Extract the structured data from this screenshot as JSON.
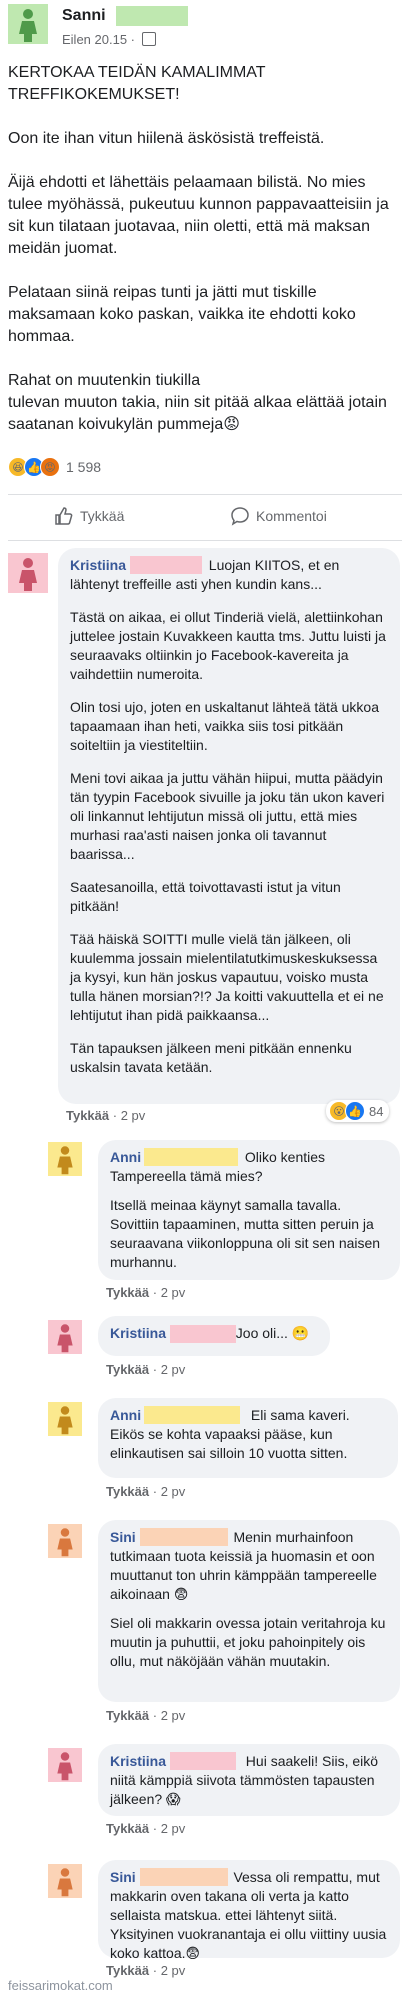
{
  "post": {
    "author": "Sanni",
    "time": "Eilen 20.15 · ",
    "paragraphs": [
      "KERTOKAA TEIDÄN KAMALIMMAT TREFFIKOKEMUKSET!",
      "Oon ite ihan vitun hiilenä äskösistä treffeistä.",
      "Äijä ehdotti et lähettäis pelaamaan bilistä. No mies tulee myöhässä, pukeutuu kunnon pappavaatteisiin ja sit kun tilataan juotavaa, niin oletti, että mä maksan meidän juomat.",
      "Pelataan siinä reipas tunti ja jätti mut tiskille maksamaan koko paskan, vaikka ite ehdotti koko hommaa.",
      "Rahat on muutenkin tiukilla\ntulevan muuton takia, niin sit pitää alkaa elättää jotain saatanan koivukylän pummeja😡"
    ],
    "reaction_count": "1 598"
  },
  "actions": {
    "like": "Tykkää",
    "comment": "Kommentoi"
  },
  "comments": [
    {
      "name": "Kristiina",
      "first": "Luojan KIITOS, et en lähtenyt treffeille asti yhen kundin kans...",
      "paragraphs": [
        "Tästä on aikaa, ei ollut Tinderiä vielä, alettiinkohan juttelee jostain Kuvakkeen kautta tms. Juttu luisti ja seuraavaks oltiinkin jo Facebook-kavereita ja vaihdettiin numeroita.",
        "Olin tosi ujo, joten en uskaltanut lähteä tätä ukkoa tapaamaan ihan heti, vaikka siis tosi pitkään soiteltiin ja viestiteltiin.",
        "Meni tovi aikaa ja juttu vähän hiipui, mutta päädyin tän tyypin Facebook sivuille ja joku tän ukon kaveri oli linkannut lehtijutun missä oli juttu, että mies murhasi raa'asti naisen jonka oli tavannut baarissa...",
        "Saatesanoilla, että toivottavasti istut ja vitun pitkään!",
        "Tää häiskä SOITTI mulle vielä tän jälkeen, oli kuulemma jossain mielentilatutkimuskeskuksessa ja kysyi, kun hän joskus vapautuu, voisko musta tulla hänen morsian?!? Ja koitti vakuuttella et ei ne lehtijutut ihan pidä paikkaansa...",
        "Tän tapauksen jälkeen meni pitkään ennenku uskalsin tavata ketään."
      ],
      "meta": "2 pv",
      "reaction_count": "84"
    },
    {
      "name": "Anni",
      "first": "Oliko kenties Tampereella tämä mies?",
      "paragraphs": [
        "Itsellä meinaa käynyt samalla tavalla. Sovittiin tapaaminen, mutta sitten peruin ja seuraavana viikonloppuna oli sit sen naisen murhannu."
      ],
      "meta": "2 pv"
    },
    {
      "name": "Kristiina",
      "first": "Joo oli... 😬",
      "paragraphs": [],
      "meta": "2 pv"
    },
    {
      "name": "Anni",
      "first": "Eli sama kaveri. Eikös se kohta vapaaksi pääse, kun elinkautisen sai silloin 10 vuotta sitten.",
      "paragraphs": [],
      "meta": "2 pv"
    },
    {
      "name": "Sini",
      "first": "Menin murhainfoon tutkimaan tuota keissiä ja huomasin et oon muuttanut ton uhrin kämppään tampereelle aikoinaan 😨",
      "paragraphs": [
        "Siel oli makkarin ovessa jotain veritahroja ku muutin ja puhuttii, et joku pahoinpitely ois ollu, mut näköjään vähän muutakin."
      ],
      "meta": "2 pv"
    },
    {
      "name": "Kristiina",
      "first": "Hui saakeli! Siis, eikö niitä kämppiä siivota tämmösten tapausten jälkeen? 😱",
      "paragraphs": [],
      "meta": "2 pv"
    },
    {
      "name": "Sini",
      "first": "Vessa oli rempattu, mut makkarin oven takana oli verta ja katto sellaista matskua. ettei lähtenyt siitä. Yksityinen vuokranantaja ei ollu viittiny uusia koko kattoa.😨",
      "paragraphs": [],
      "meta": "2 pv"
    }
  ],
  "meta_like": "Tykkää",
  "meta_sep": " · ",
  "watermark": "feissarimokat.com",
  "colors": {
    "link": "#385898",
    "bubble": "#f0f2f5",
    "avatar_green": "#bfe8b0",
    "avatar_pink": "#f9c6d0",
    "avatar_yellow": "#fbe98e",
    "avatar_peach": "#fbd3b6",
    "redact_green": "#bfe8b0",
    "redact_pink": "#f9c6d0",
    "redact_yellow": "#fbe98e",
    "redact_peach": "#fbd3b6"
  },
  "icons": [
    "like-icon",
    "comment-icon",
    "haha-icon",
    "thumbs-up-icon",
    "angry-icon",
    "wow-icon",
    "person-silhouette-icon",
    "globe-icon"
  ]
}
